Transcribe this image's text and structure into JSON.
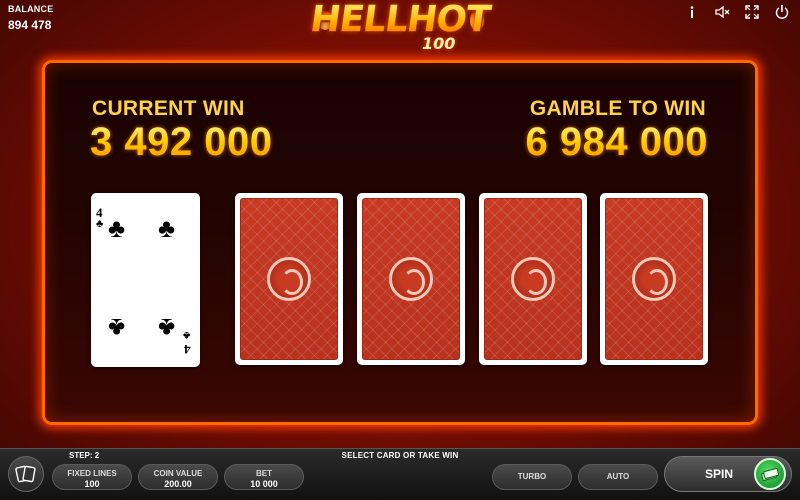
{
  "balance": {
    "label": "BALANCE",
    "value": "894 478"
  },
  "logo": {
    "main": "HELLHOT",
    "sub": "100"
  },
  "top_icons": [
    "info-icon",
    "sound-off-icon",
    "fullscreen-icon",
    "power-icon"
  ],
  "current_win": {
    "label": "CURRENT WIN",
    "value": "3 492 000"
  },
  "gamble_to_win": {
    "label": "GAMBLE TO WIN",
    "value": "6 984 000"
  },
  "dealer_card": {
    "rank": "4",
    "suit": "clubs",
    "suit_glyph": "♣"
  },
  "face_down_cards": 4,
  "bottom": {
    "step": "STEP: 2",
    "hint": "SELECT CARD OR TAKE WIN",
    "fixed_lines": {
      "label": "FIXED LINES",
      "value": "100"
    },
    "coin_value": {
      "label": "COIN VALUE",
      "value": "200.00"
    },
    "bet": {
      "label": "BET",
      "value": "10 000"
    },
    "turbo": "TURBO",
    "auto": "AUTO",
    "spin": "SPIN"
  },
  "colors": {
    "accent": "#ffd34a",
    "frame": "#ff6a00",
    "background": "#6e0c03",
    "card_back": "#c73a24",
    "spin_icon": "#1e9e34"
  }
}
